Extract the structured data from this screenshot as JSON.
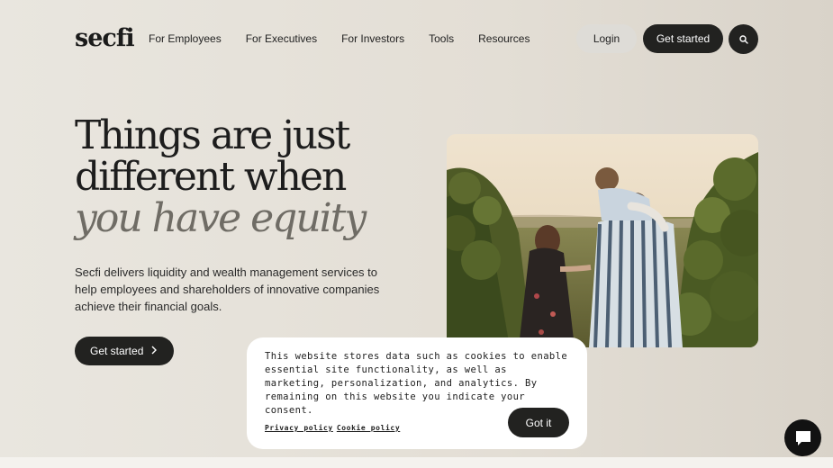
{
  "header": {
    "logo": "secfi",
    "nav": [
      "For Employees",
      "For Executives",
      "For Investors",
      "Tools",
      "Resources"
    ],
    "login_label": "Login",
    "get_started_label": "Get started",
    "search_icon": "search-icon"
  },
  "hero": {
    "title_line1": "Things are just",
    "title_line2": "different when",
    "title_line3": "you have equity",
    "description": "Secfi delivers liquidity and wealth management services to help employees and shareholders of innovative companies achieve their financial goals.",
    "cta_label": "Get started",
    "cta_icon": "chevron-right-icon",
    "photo_icon": "family-in-vineyard-photo"
  },
  "cookie_banner": {
    "text": "This website stores data such as cookies to enable essential site functionality, as well as marketing, personalization, and analytics. By remaining on this website you indicate your consent.",
    "privacy_link": "Privacy policy",
    "cookie_link": "Cookie policy",
    "accept_label": "Got it"
  },
  "chat": {
    "icon": "chat-bubble-icon"
  },
  "colors": {
    "background": "#e7e3db",
    "dark_button": "#222220",
    "light_button": "#dedcd7",
    "banner": "#ffffff"
  }
}
